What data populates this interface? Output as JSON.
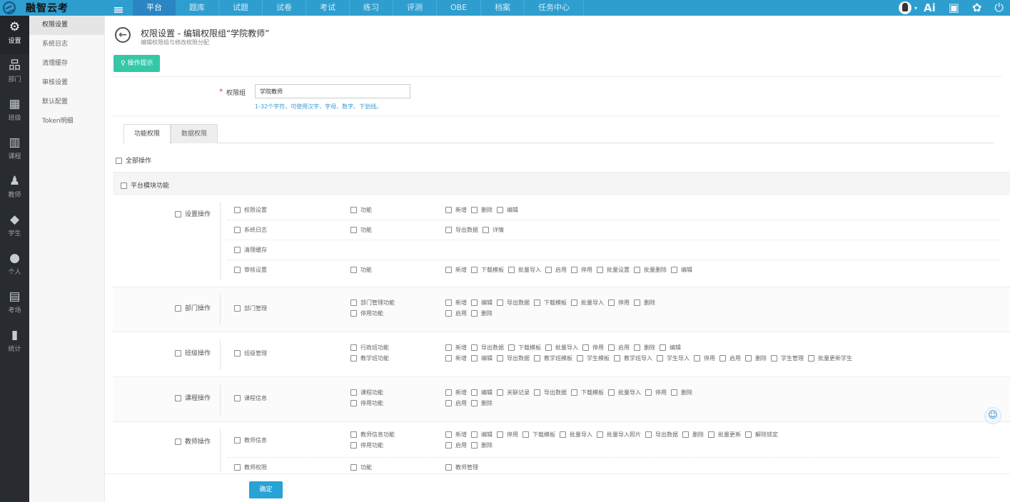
{
  "app": {
    "name": "融智云考"
  },
  "nav": [
    "平台",
    "题库",
    "试题",
    "试卷",
    "考试",
    "练习",
    "评测",
    "OBE",
    "档案",
    "任务中心"
  ],
  "topbar_icons": [
    "user-avatar-icon",
    "ai-icon",
    "note-icon",
    "palette-icon",
    "power-icon"
  ],
  "topbar_ai": "Ai",
  "rail": [
    {
      "label": "设置",
      "icon": "⚙"
    },
    {
      "label": "部门",
      "icon": "品"
    },
    {
      "label": "班级",
      "icon": "▦"
    },
    {
      "label": "课程",
      "icon": "▥"
    },
    {
      "label": "教师",
      "icon": "♟"
    },
    {
      "label": "学生",
      "icon": "◆"
    },
    {
      "label": "个人",
      "icon": "●"
    },
    {
      "label": "考场",
      "icon": "▤"
    },
    {
      "label": "统计",
      "icon": "▮"
    }
  ],
  "sidemenu": [
    "权限设置",
    "系统日志",
    "清理缓存",
    "审核设置",
    "默认配置",
    "Token明细"
  ],
  "page": {
    "title": "权限设置 - 编辑权限组“学院教师”",
    "subtitle": "编辑权限组与修改权限分配",
    "tip_button": "操作提示",
    "back": "←"
  },
  "form": {
    "required_mark": "*",
    "label": "权限组",
    "value": "学院教师",
    "hint": "1-32个字符，可使用汉字、字母、数字、下划线。"
  },
  "tabs": [
    "功能权限",
    "数据权限"
  ],
  "check_all": "全部操作",
  "module": "平台模块功能",
  "groups": [
    {
      "label": "设置操作",
      "rows": [
        {
          "name": "权限设置",
          "func": [
            "功能"
          ],
          "actions": [
            [
              "新增",
              "删除",
              "编辑"
            ]
          ]
        },
        {
          "name": "系统日志",
          "func": [
            "功能"
          ],
          "actions": [
            [
              "导出数据",
              "详情"
            ]
          ]
        },
        {
          "name": "清理缓存",
          "func": [],
          "actions": []
        },
        {
          "name": "审核设置",
          "func": [
            "功能"
          ],
          "actions": [
            [
              "新增",
              "下载模板",
              "批量导入",
              "启用",
              "停用",
              "批量设置",
              "批量删除",
              "编辑"
            ]
          ]
        }
      ]
    },
    {
      "label": "部门操作",
      "rows": [
        {
          "name": "部门管理",
          "func": [
            "部门管理功能",
            "停用功能"
          ],
          "actions": [
            [
              "新增",
              "编辑",
              "导出数据",
              "下载模板",
              "批量导入",
              "停用",
              "删除"
            ],
            [
              "启用",
              "删除"
            ]
          ]
        }
      ]
    },
    {
      "label": "班级操作",
      "rows": [
        {
          "name": "班级管理",
          "func": [
            "行政班功能",
            "教学班功能"
          ],
          "actions": [
            [
              "新增",
              "导出数据",
              "下载模板",
              "批量导入",
              "停用",
              "启用",
              "删除",
              "编辑"
            ],
            [
              "新增",
              "编辑",
              "导出数据",
              "教学班模板",
              "学生模板",
              "教学班导入",
              "学生导入",
              "停用",
              "启用",
              "删除",
              "学生管理",
              "批量更新学生"
            ]
          ]
        }
      ]
    },
    {
      "label": "课程操作",
      "rows": [
        {
          "name": "课程信息",
          "func": [
            "课程功能",
            "停用功能"
          ],
          "actions": [
            [
              "新增",
              "编辑",
              "关联记录",
              "导出数据",
              "下载模板",
              "批量导入",
              "停用",
              "删除"
            ],
            [
              "启用",
              "删除"
            ]
          ]
        }
      ]
    },
    {
      "label": "教师操作",
      "rows": [
        {
          "name": "教师信息",
          "func": [
            "教师信息功能",
            "停用功能"
          ],
          "actions": [
            [
              "新增",
              "编辑",
              "停用",
              "下载模板",
              "批量导入",
              "批量导入照片",
              "导出数据",
              "删除",
              "批量更新",
              "解除锁定"
            ],
            [
              "启用",
              "删除"
            ]
          ]
        },
        {
          "name": "教师权限",
          "func": [
            "功能"
          ],
          "actions": [
            [
              "教师管理"
            ]
          ]
        }
      ]
    }
  ],
  "confirm": "确定"
}
